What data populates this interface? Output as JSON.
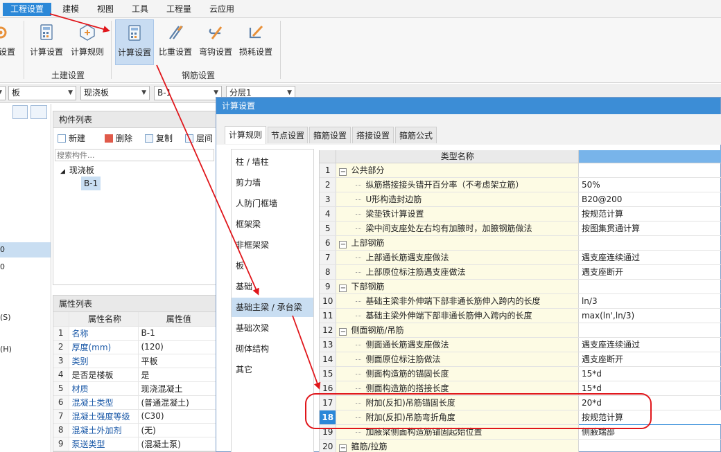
{
  "menu": [
    "工程设置",
    "建模",
    "视图",
    "工具",
    "工程量",
    "云应用"
  ],
  "ribbon": {
    "partial_label": "设置",
    "civil_group": {
      "label": "土建设置",
      "buttons": [
        "计算设置",
        "计算规则"
      ]
    },
    "rebar_group": {
      "label": "钢筋设置",
      "buttons": [
        "计算设置",
        "比重设置",
        "弯钩设置",
        "损耗设置"
      ]
    }
  },
  "toolbar": {
    "combo1": "板",
    "combo2": "现浇板",
    "combo3": "B-1",
    "combo4": "分层1"
  },
  "left_strip": [
    "0",
    "0",
    "(S)",
    "(H)"
  ],
  "component_list": {
    "title": "构件列表",
    "new_label": "新建",
    "delete_label": "删除",
    "copy_label": "复制",
    "layer_label": "层间",
    "search_placeholder": "搜索构件...",
    "tree_root": "现浇板",
    "tree_child": "B-1"
  },
  "property_list": {
    "title": "属性列表",
    "headers": [
      "属性名称",
      "属性值"
    ],
    "rows": [
      {
        "num": "1",
        "name": "名称",
        "value": "B-1"
      },
      {
        "num": "2",
        "name": "厚度(mm)",
        "value": "(120)"
      },
      {
        "num": "3",
        "name": "类别",
        "value": "平板"
      },
      {
        "num": "4",
        "name": "是否是楼板",
        "value": "是"
      },
      {
        "num": "5",
        "name": "材质",
        "value": "现浇混凝土"
      },
      {
        "num": "6",
        "name": "混凝土类型",
        "value": "(普通混凝土)"
      },
      {
        "num": "7",
        "name": "混凝土强度等级",
        "value": "(C30)"
      },
      {
        "num": "8",
        "name": "混凝土外加剂",
        "value": "(无)"
      },
      {
        "num": "9",
        "name": "泵送类型",
        "value": "(混凝土泵)"
      }
    ]
  },
  "dialog": {
    "title": "计算设置",
    "tabs": [
      "计算规则",
      "节点设置",
      "箍筋设置",
      "搭接设置",
      "箍筋公式"
    ],
    "categories": [
      "柱 / 墙柱",
      "剪力墙",
      "人防门框墙",
      "框架梁",
      "非框架梁",
      "板",
      "基础",
      "基础主梁 / 承台梁",
      "基础次梁",
      "砌体结构",
      "其它"
    ],
    "selected_category": "基础主梁 / 承台梁",
    "grid_header": "类型名称",
    "rows": [
      {
        "num": "1",
        "name": "公共部分",
        "value": "",
        "group": true
      },
      {
        "num": "2",
        "name": "纵筋搭接接头错开百分率（不考虑架立筋）",
        "value": "50%"
      },
      {
        "num": "3",
        "name": "U形构造封边筋",
        "value": "B20@200"
      },
      {
        "num": "4",
        "name": "梁垫铁计算设置",
        "value": "按规范计算"
      },
      {
        "num": "5",
        "name": "梁中间支座处左右均有加腋时，加腋钢筋做法",
        "value": "按图集贯通计算"
      },
      {
        "num": "6",
        "name": "上部钢筋",
        "value": "",
        "group": true
      },
      {
        "num": "7",
        "name": "上部通长筋遇支座做法",
        "value": "遇支座连续通过"
      },
      {
        "num": "8",
        "name": "上部原位标注筋遇支座做法",
        "value": "遇支座断开"
      },
      {
        "num": "9",
        "name": "下部钢筋",
        "value": "",
        "group": true
      },
      {
        "num": "10",
        "name": "基础主梁非外伸端下部非通长筋伸入跨内的长度",
        "value": "ln/3"
      },
      {
        "num": "11",
        "name": "基础主梁外伸端下部非通长筋伸入跨内的长度",
        "value": "max(ln',ln/3)"
      },
      {
        "num": "12",
        "name": "侧面钢筋/吊筋",
        "value": "",
        "group": true
      },
      {
        "num": "13",
        "name": "侧面通长筋遇支座做法",
        "value": "遇支座连续通过"
      },
      {
        "num": "14",
        "name": "侧面原位标注筋做法",
        "value": "遇支座断开"
      },
      {
        "num": "15",
        "name": "侧面构造筋的锚固长度",
        "value": "15*d"
      },
      {
        "num": "16",
        "name": "侧面构造筋的搭接长度",
        "value": "15*d"
      },
      {
        "num": "17",
        "name": "附加(反扣)吊筋锚固长度",
        "value": "20*d"
      },
      {
        "num": "18",
        "name": "附加(反扣)吊筋弯折角度",
        "value": "按规范计算",
        "current": true
      },
      {
        "num": "19",
        "name": "加腋梁侧面构造筋锚固起始位置",
        "value": "侧腋端部"
      },
      {
        "num": "20",
        "name": "箍筋/拉筋",
        "value": "",
        "group": true
      }
    ]
  },
  "colors": {
    "accent": "#2b88d8",
    "annotation": "#e0161b",
    "title_bar": "#3c8dd6"
  }
}
